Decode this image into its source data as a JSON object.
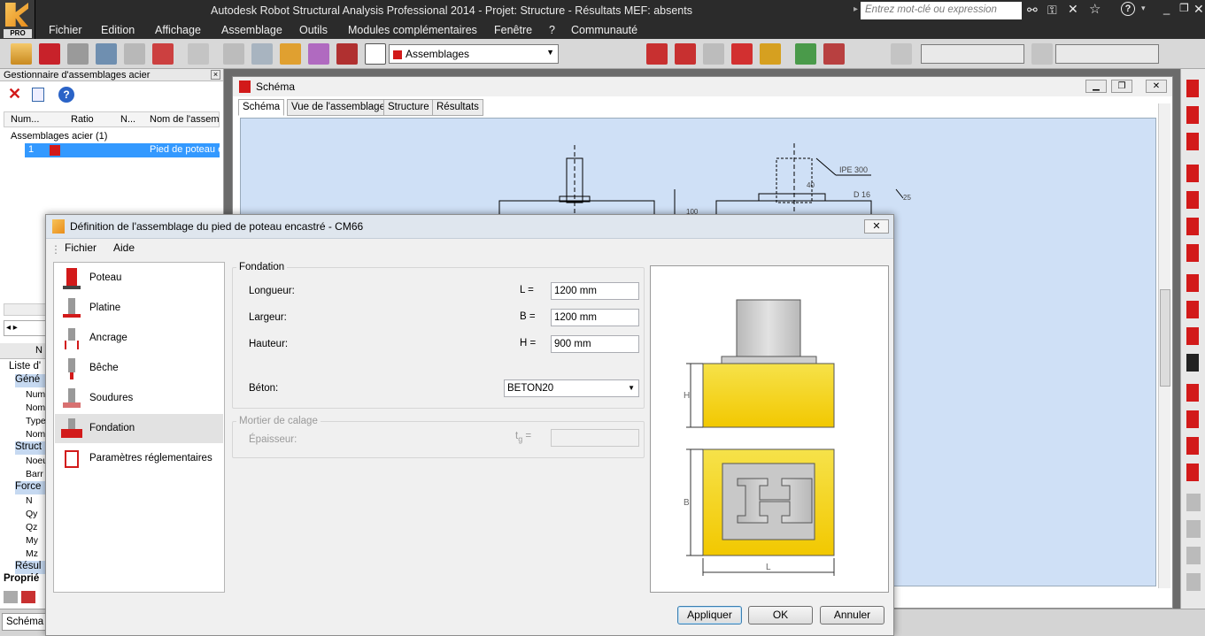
{
  "app": {
    "title": "Autodesk Robot Structural Analysis Professional 2014 - Projet: Structure - Résultats MEF: absents",
    "search_placeholder": "Entrez mot-clé ou expression",
    "logo_text": "PRO",
    "menu": [
      "Fichier",
      "Edition",
      "Affichage",
      "Assemblage",
      "Outils",
      "Modules complémentaires",
      "Fenêtre",
      "?",
      "Communauté"
    ],
    "toolbar_combo": "Assemblages"
  },
  "manager": {
    "title": "Gestionnaire d'assemblages acier",
    "columns": [
      "Num...",
      "Ratio",
      "N...",
      "Nom de l'assemb"
    ],
    "group": "Assemblages acier (1)",
    "row": {
      "num": "1",
      "name": "Pied de poteau e"
    }
  },
  "props": {
    "header": "N",
    "rows": [
      "Liste d'",
      "Géné",
      "Num",
      "Nom",
      "Type",
      "Nom",
      "Struct",
      "Noeu",
      "Barr",
      "Force",
      "N",
      "Qy",
      "Qz",
      "My",
      "Mz",
      "Résul"
    ],
    "tab": "Proprié"
  },
  "schema": {
    "title": "Schéma",
    "tabs": [
      "Schéma",
      "Vue de l'assemblage",
      "Structure",
      "Résultats"
    ],
    "annotations": {
      "profile": "IPE 300",
      "bolt": "D 16",
      "dim1": "40",
      "dim2": "25",
      "dim3": "100"
    }
  },
  "dialog": {
    "title": "Définition de l'assemblage du pied de poteau encastré - CM66",
    "menu": [
      "Fichier",
      "Aide"
    ],
    "items": [
      {
        "label": "Poteau",
        "icon": "column-icon"
      },
      {
        "label": "Platine",
        "icon": "base-plate-icon"
      },
      {
        "label": "Ancrage",
        "icon": "anchor-icon"
      },
      {
        "label": "Bêche",
        "icon": "shear-key-icon"
      },
      {
        "label": "Soudures",
        "icon": "weld-icon"
      },
      {
        "label": "Fondation",
        "icon": "foundation-icon",
        "selected": true
      },
      {
        "label": "Paramètres réglementaires",
        "icon": "code-parameters-icon"
      }
    ],
    "fondation": {
      "group_title": "Fondation",
      "longueur_label": "Longueur:",
      "longueur_sym": "L =",
      "longueur_value": "1200 mm",
      "largeur_label": "Largeur:",
      "largeur_sym": "B =",
      "largeur_value": "1200 mm",
      "hauteur_label": "Hauteur:",
      "hauteur_sym": "H =",
      "hauteur_value": "900 mm",
      "beton_label": "Béton:",
      "beton_value": "BETON20"
    },
    "mortier": {
      "group_title": "Mortier de calage",
      "epaisseur_label": "Épaisseur:",
      "epaisseur_sym": "t",
      "epaisseur_sub": "g",
      "epaisseur_eq": "=",
      "epaisseur_value": ""
    },
    "preview": {
      "h": "H",
      "b": "B",
      "l": "L"
    },
    "buttons": {
      "apply": "Appliquer",
      "ok": "OK",
      "cancel": "Annuler"
    }
  },
  "status": {
    "text": "Schéma"
  },
  "colors": {
    "accent_red": "#d21a1a",
    "concrete": "#f5c800",
    "canvas": "#cfe0f6",
    "selection": "#3399ff"
  }
}
